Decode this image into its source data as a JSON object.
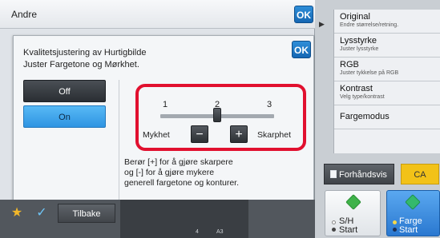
{
  "window": {
    "title": "Andre",
    "ok_label": "OK"
  },
  "dialog": {
    "title_line1": "Kvalitetsjustering av Hurtigbilde",
    "title_line2": "Juster Fargetone og Mørkhet.",
    "ok_label": "OK",
    "off_label": "Off",
    "on_label": "On",
    "selected_mode": "On",
    "slider": {
      "ticks": [
        "1",
        "2",
        "3"
      ],
      "value": 2,
      "min": 1,
      "max": 3,
      "left_label": "Mykhet",
      "right_label": "Skarphet",
      "minus_label": "−",
      "plus_label": "+"
    },
    "description_line1": "Berør [+] for å gjøre skarpere",
    "description_line2": "og [-] for å gjøre mykere",
    "description_line3": "generell fargetone og konturer."
  },
  "bottom_bar": {
    "back_label": "Tilbake",
    "star_icon": "★",
    "check_icon": "✓",
    "paper_count": "4",
    "paper_size": "A3"
  },
  "right_panel": {
    "expand_icon": "▶",
    "menu": [
      {
        "title": "Original",
        "subtitle": "Endre størrelse/retning."
      },
      {
        "title": "Lysstyrke",
        "subtitle": "Juster lysstyrke"
      },
      {
        "title": "RGB",
        "subtitle": "Juster tykkelse på RGB"
      },
      {
        "title": "Kontrast",
        "subtitle": "Velg type/kontrast"
      },
      {
        "title": "Fargemodus",
        "subtitle": ""
      }
    ],
    "preview_label": "Forhåndsvis",
    "ca_label": "CA",
    "sh_start": {
      "line1": "S/H",
      "line2": "Start"
    },
    "color_start": {
      "line1": "Farge",
      "line2": "Start"
    }
  },
  "colors": {
    "highlight_border": "#e1102f",
    "on_button": "#2e94e2",
    "ok_button": "#1667b3",
    "ca_button": "#f2c218",
    "color_start": "#2a78d0"
  }
}
